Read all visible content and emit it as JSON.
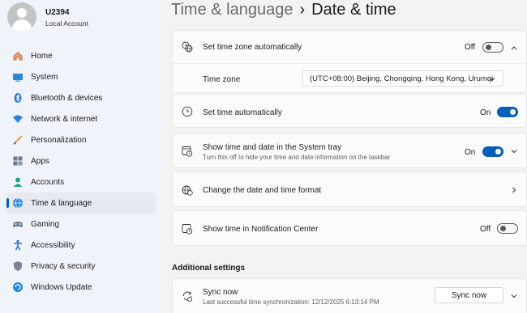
{
  "user": {
    "name": "U2394",
    "account_type": "Local Account"
  },
  "nav": [
    {
      "label": "Home",
      "icon": "home-icon"
    },
    {
      "label": "System",
      "icon": "system-icon"
    },
    {
      "label": "Bluetooth & devices",
      "icon": "bluetooth-icon"
    },
    {
      "label": "Network & internet",
      "icon": "wifi-icon"
    },
    {
      "label": "Personalization",
      "icon": "brush-icon"
    },
    {
      "label": "Apps",
      "icon": "apps-icon"
    },
    {
      "label": "Accounts",
      "icon": "accounts-icon"
    },
    {
      "label": "Time & language",
      "icon": "globe-clock-icon",
      "active": true
    },
    {
      "label": "Gaming",
      "icon": "gamepad-icon"
    },
    {
      "label": "Accessibility",
      "icon": "accessibility-icon"
    },
    {
      "label": "Privacy & security",
      "icon": "shield-icon"
    },
    {
      "label": "Windows Update",
      "icon": "update-icon"
    }
  ],
  "header": {
    "breadcrumb": "Time & language",
    "separator": "›",
    "current": "Date & time"
  },
  "settings": {
    "tz_auto": {
      "label": "Set time zone automatically",
      "state": "Off"
    },
    "time_zone": {
      "label": "Time zone",
      "value": "(UTC+08:00) Beijing, Chongqing, Hong Kong, Urumqi"
    },
    "time_auto": {
      "label": "Set time automatically",
      "state": "On"
    },
    "tray": {
      "label": "Show time and date in the System tray",
      "sublabel": "Turn this off to hide your time and date information on the taskbar",
      "state": "On"
    },
    "format": {
      "label": "Change the date and time format"
    },
    "notif": {
      "label": "Show time in Notification Center",
      "state": "Off"
    }
  },
  "additional": {
    "heading": "Additional settings",
    "sync": {
      "label": "Sync now",
      "sublabel": "Last successful time synchronization: 12/12/2025 6:13:14 PM",
      "button": "Sync now"
    }
  },
  "colors": {
    "accent": "#005fb8",
    "background": "#f3f3f3",
    "card": "#fbfbfb"
  }
}
